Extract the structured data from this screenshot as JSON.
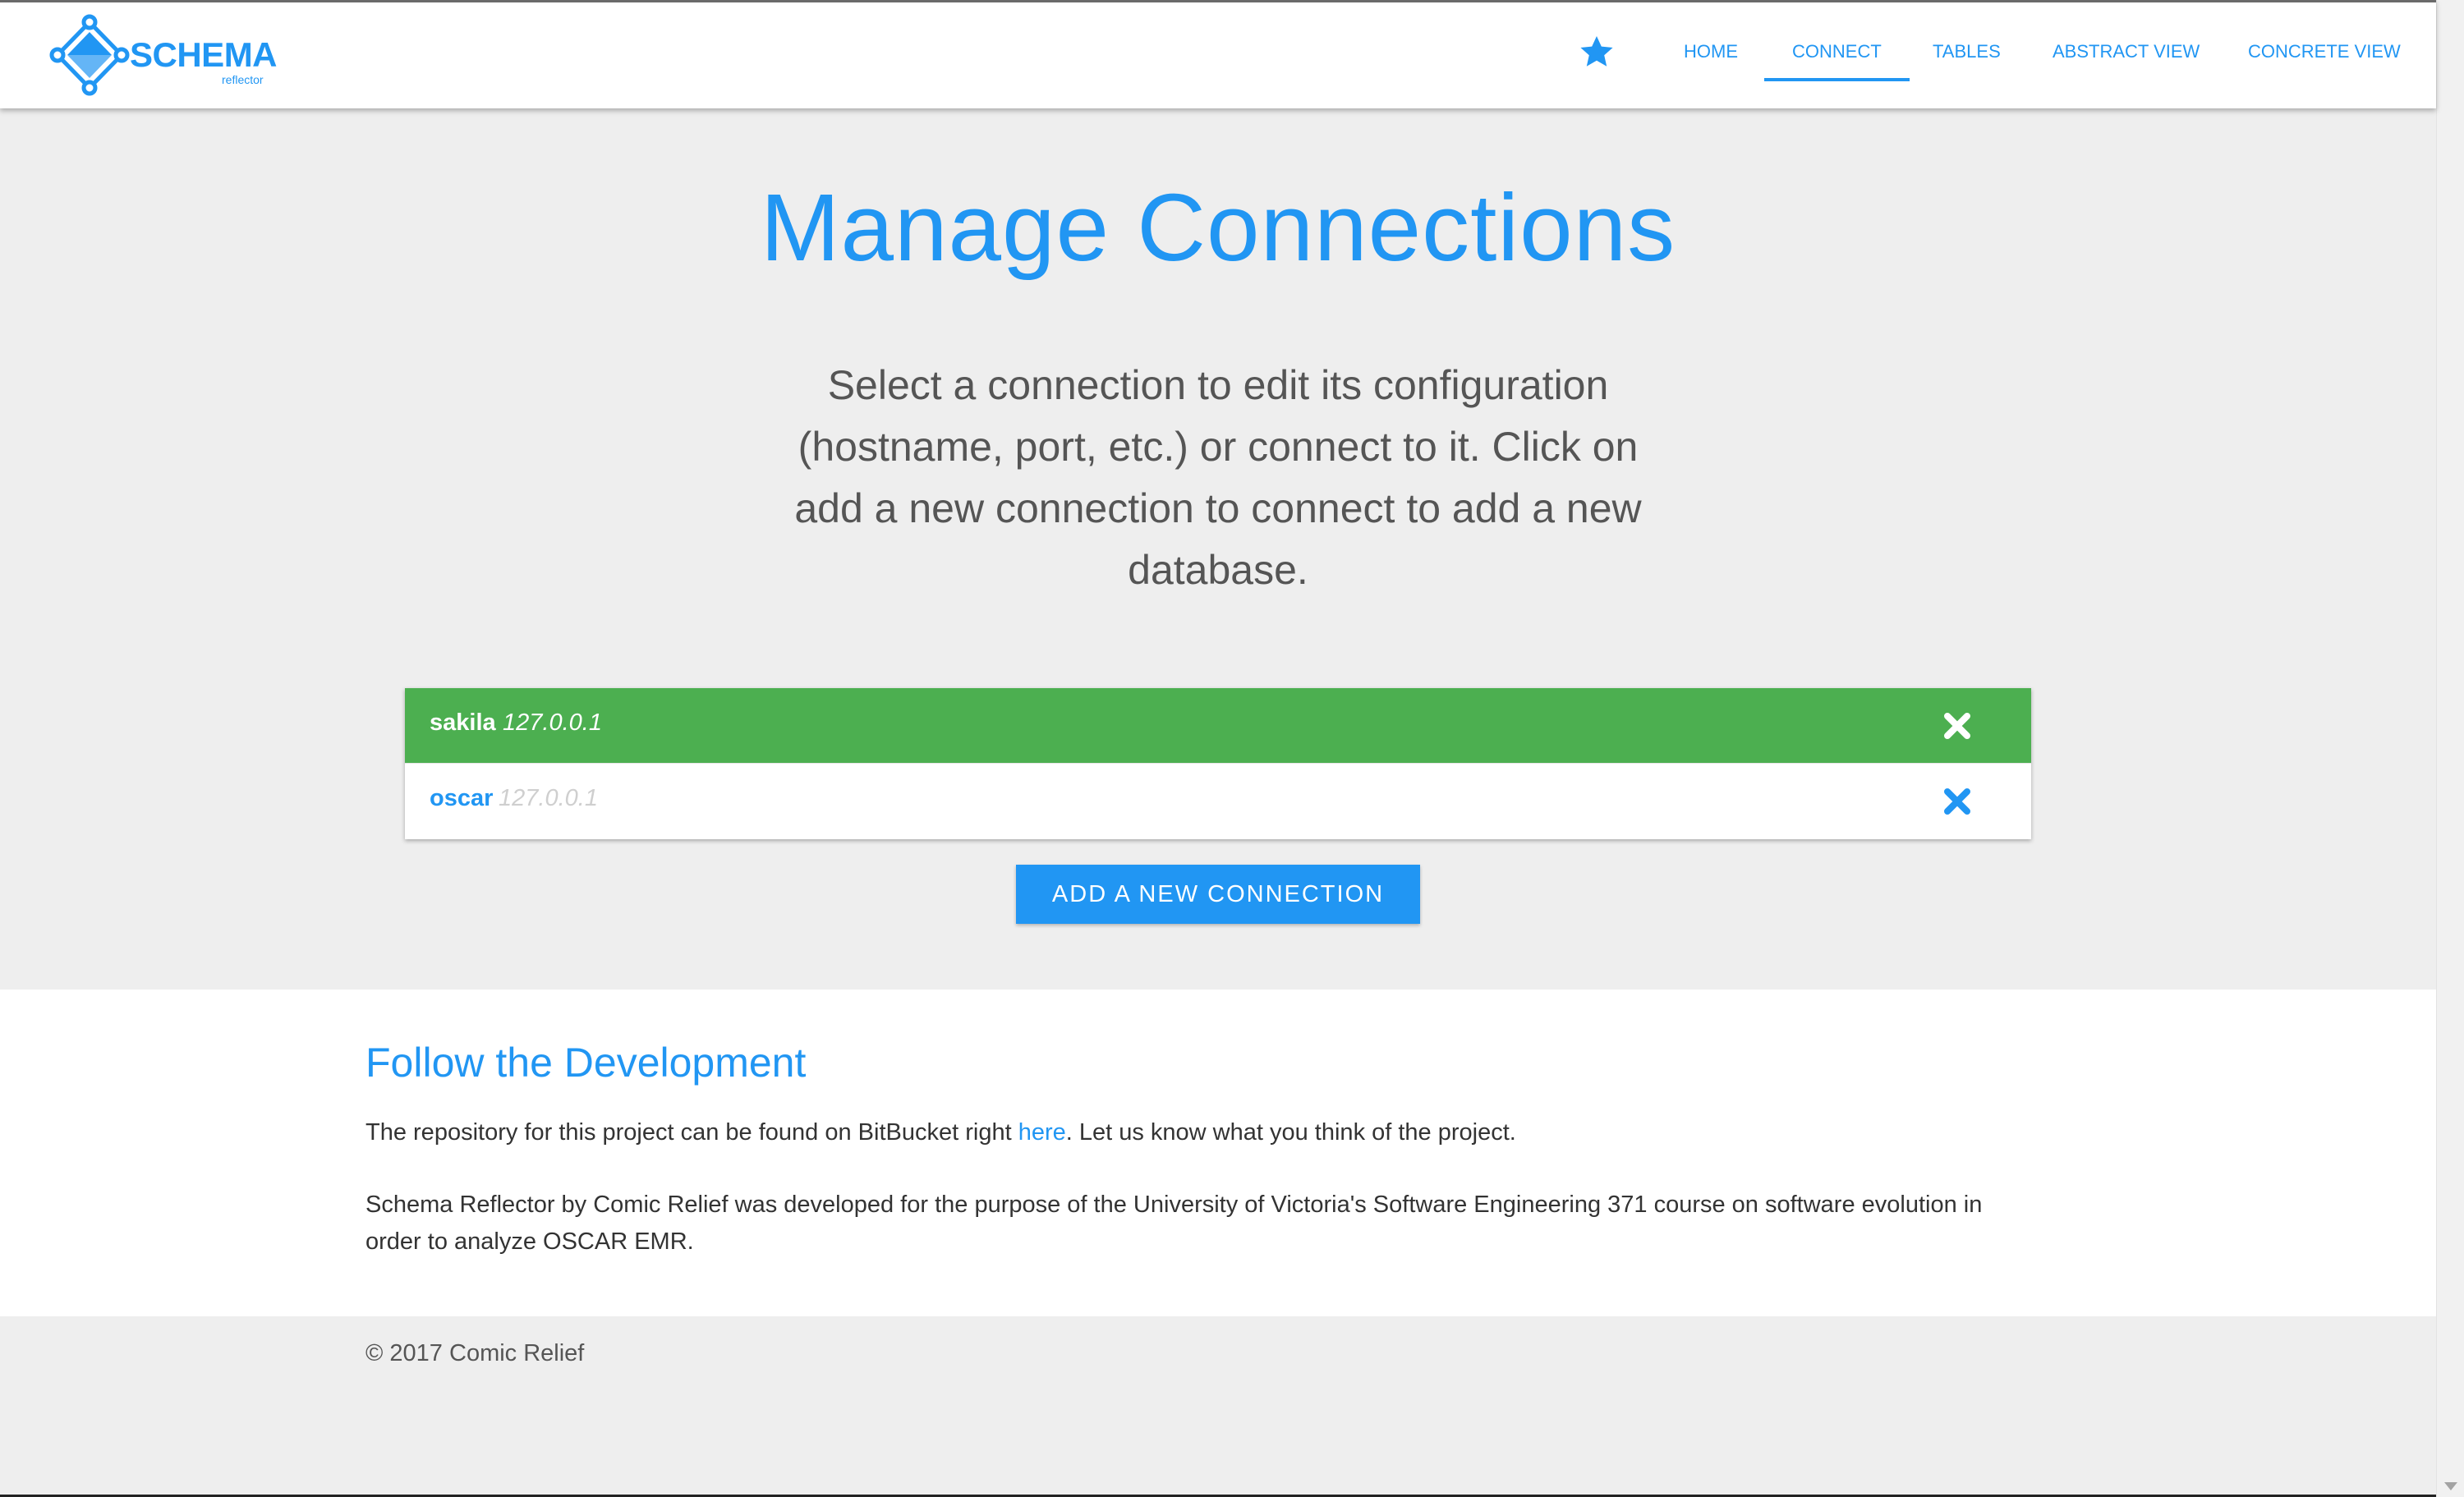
{
  "brand": {
    "name": "SCHEMA",
    "tagline": "reflector",
    "color": "#2196f3"
  },
  "nav": {
    "favorite_icon": "star-icon",
    "links": [
      {
        "label": "HOME",
        "active": false
      },
      {
        "label": "CONNECT",
        "active": true
      },
      {
        "label": "TABLES",
        "active": false
      },
      {
        "label": "ABSTRACT VIEW",
        "active": false
      },
      {
        "label": "CONCRETE VIEW",
        "active": false
      }
    ]
  },
  "main": {
    "title": "Manage Connections",
    "intro": "Select a connection to edit its configuration (hostname, port, etc.) or connect to it. Click on add a new connection to connect to add a new database.",
    "connections": [
      {
        "name": "sakila",
        "host": "127.0.0.1",
        "active": true,
        "remove_icon": "close-icon"
      },
      {
        "name": "oscar",
        "host": "127.0.0.1",
        "active": false,
        "remove_icon": "close-icon"
      }
    ],
    "add_button": "ADD A NEW CONNECTION",
    "active_color": "#4caf50"
  },
  "footer": {
    "title": "Follow the Development",
    "repo_text_before": "The repository for this project can be found on BitBucket right ",
    "repo_link": "here",
    "repo_text_after": ". Let us know what you think of the project.",
    "about": "Schema Reflector by Comic Relief was developed for the purpose of the University of Victoria's Software Engineering 371 course on software evolution in order to analyze OSCAR EMR.",
    "copyright": "© 2017 Comic Relief"
  }
}
